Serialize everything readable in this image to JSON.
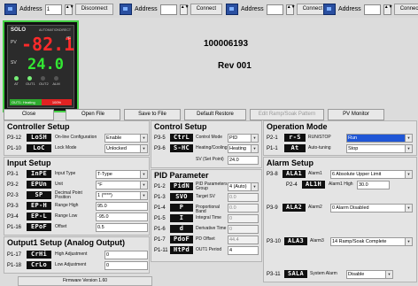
{
  "topbar": {
    "address_label": "Address",
    "groups": [
      {
        "address": "1",
        "button": "Disconnect"
      },
      {
        "address": "",
        "button": "Connect"
      },
      {
        "address": "",
        "button": "Connect"
      },
      {
        "address": "",
        "button": "Connect"
      }
    ]
  },
  "device": {
    "logo": "SOLO",
    "brand_small": "AUTOMATIONDIRECT",
    "pv_label": "PV",
    "sv_label": "SV",
    "pv_value": "-82.1",
    "sv_value": "24.0",
    "unit": "°F",
    "leds": [
      "AT",
      "OUT1",
      "OUT2",
      "ALM"
    ],
    "status_left": "OUT1: Heating",
    "status_right": "100%"
  },
  "info": {
    "serial": "100006193",
    "revision": "Rev 001"
  },
  "toolbar": {
    "close": "Close",
    "open": "Open File",
    "save": "Save to File",
    "restore": "Default Restore",
    "edit_ramp": "Edit Ramp/Soak Pattern",
    "monitor": "PV Monitor"
  },
  "controller_setup": {
    "title": "Controller Setup",
    "rows": [
      {
        "code": "P3-12",
        "lcd": "LoSH",
        "name": "On-line Configuration",
        "value": "Enable"
      },
      {
        "code": "P1-10",
        "lcd": "LoC",
        "name": "Lock Mode",
        "value": "Unlocked"
      }
    ]
  },
  "input_setup": {
    "title": "Input Setup",
    "rows": [
      {
        "code": "P3-1",
        "lcd": "InPE",
        "name": "Input Type",
        "value": "T-Type"
      },
      {
        "code": "P3-2",
        "lcd": "EPUn",
        "name": "Unit",
        "value": "°F"
      },
      {
        "code": "P2-3",
        "lcd": "SP",
        "name": "Decimal Point Position",
        "value": "1 (****)"
      },
      {
        "code": "P3-3",
        "lcd": "EP-H",
        "name": "Range High",
        "value": "95.0"
      },
      {
        "code": "P3-4",
        "lcd": "EP-L",
        "name": "Range Low",
        "value": "-95.0"
      },
      {
        "code": "P1-16",
        "lcd": "EPoF",
        "name": "Offset",
        "value": "0.5"
      }
    ]
  },
  "output_setup": {
    "title": "Output1 Setup (Analog Output)",
    "rows": [
      {
        "code": "P1-17",
        "lcd": "CrHi",
        "name": "High Adjustment",
        "value": "0"
      },
      {
        "code": "P1-18",
        "lcd": "CrLo",
        "name": "Low Adjustment",
        "value": "0"
      }
    ]
  },
  "control_setup": {
    "title": "Control Setup",
    "rows": [
      {
        "code": "P3-5",
        "lcd": "CtrL",
        "name": "Control Mode",
        "value": "PID"
      },
      {
        "code": "P3-6",
        "lcd": "S-HC",
        "name": "Heating/Cooling",
        "value": "Heating"
      },
      {
        "code": "",
        "lcd": "",
        "name": "SV (Set Point)",
        "value": "24.0"
      }
    ]
  },
  "pid_parameter": {
    "title": "PID Parameter",
    "rows": [
      {
        "code": "P1-2",
        "lcd": "PidN",
        "name": "PID Parameters Group",
        "value": "4 (Auto)"
      },
      {
        "code": "P1-3",
        "lcd": "SVO",
        "name": "Target SV",
        "value": "0.0"
      },
      {
        "code": "P1-4",
        "lcd": "P",
        "name": "Proportional Band",
        "value": "0.0"
      },
      {
        "code": "P1-5",
        "lcd": "I",
        "name": "Integral Time",
        "value": "0"
      },
      {
        "code": "P1-6",
        "lcd": "d",
        "name": "Derivative Time",
        "value": "0"
      },
      {
        "code": "P1-7",
        "lcd": "PdoF",
        "name": "PD Offset",
        "value": "44.4"
      },
      {
        "code": "P1-11",
        "lcd": "HtPd",
        "name": "OUT1 Period",
        "value": "4"
      }
    ]
  },
  "operation_mode": {
    "title": "Operation Mode",
    "rows": [
      {
        "code": "P2-1",
        "lcd": "r-S",
        "name": "RUN/STOP",
        "value": "Run"
      },
      {
        "code": "P1-1",
        "lcd": "At",
        "name": "Auto-tuning",
        "value": "Stop"
      }
    ]
  },
  "alarm_setup": {
    "title": "Alarm Setup",
    "rows": [
      {
        "code": "P3-8",
        "lcd": "ALA1",
        "name": "Alarm1",
        "value": "6 Absolute Upper Limit"
      },
      {
        "code": "P2-4",
        "lcd": "AL1H",
        "name": "Alarm1 High",
        "value": "30.0"
      },
      {
        "code": "P3-9",
        "lcd": "ALA2",
        "name": "Alarm2",
        "value": "0 Alarm Disabled"
      },
      {
        "code": "P3-10",
        "lcd": "ALA3",
        "name": "Alarm3",
        "value": "14 Ramp/Soak Complete"
      },
      {
        "code": "P3-11",
        "lcd": "SALA",
        "name": "System Alarm",
        "value": "Disable"
      }
    ]
  },
  "footer": {
    "firmware": "Firmware Version 1.60"
  }
}
